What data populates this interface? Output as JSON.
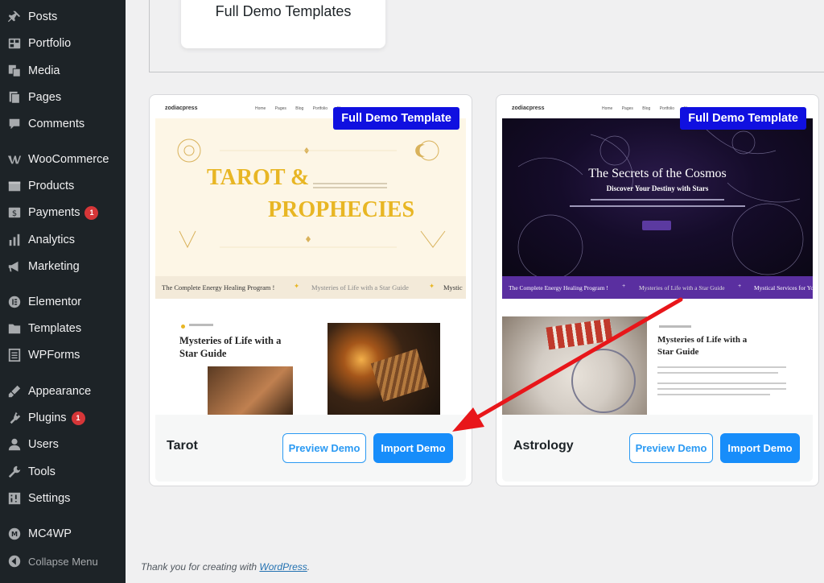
{
  "sidebar": {
    "items": [
      {
        "label": "Posts",
        "icon": "pin-icon"
      },
      {
        "label": "Portfolio",
        "icon": "portfolio-icon"
      },
      {
        "label": "Media",
        "icon": "media-icon"
      },
      {
        "label": "Pages",
        "icon": "pages-icon"
      },
      {
        "label": "Comments",
        "icon": "comments-icon"
      },
      {
        "label": "WooCommerce",
        "icon": "woocommerce-icon"
      },
      {
        "label": "Products",
        "icon": "products-icon"
      },
      {
        "label": "Payments",
        "icon": "payments-icon",
        "badge": "1"
      },
      {
        "label": "Analytics",
        "icon": "analytics-icon"
      },
      {
        "label": "Marketing",
        "icon": "marketing-icon"
      },
      {
        "label": "Elementor",
        "icon": "elementor-icon"
      },
      {
        "label": "Templates",
        "icon": "templates-icon"
      },
      {
        "label": "WPForms",
        "icon": "wpforms-icon"
      },
      {
        "label": "Appearance",
        "icon": "appearance-icon"
      },
      {
        "label": "Plugins",
        "icon": "plugins-icon",
        "badge": "1"
      },
      {
        "label": "Users",
        "icon": "users-icon"
      },
      {
        "label": "Tools",
        "icon": "tools-icon"
      },
      {
        "label": "Settings",
        "icon": "settings-icon"
      },
      {
        "label": "MC4WP",
        "icon": "mc4wp-icon"
      },
      {
        "label": "Collapse Menu",
        "icon": "collapse-icon"
      }
    ]
  },
  "top_card": {
    "title": "Full Demo Templates"
  },
  "cards": [
    {
      "name": "Tarot",
      "badge": "Full Demo Template",
      "preview_label": "Preview Demo",
      "import_label": "Import Demo",
      "thumb": {
        "logo": "zodiacpress",
        "nav": "Home Pages Blog Portfolio Shop",
        "headline_1": "TAROT &",
        "headline_2": "PROPHECIES",
        "ticker_1": "The Complete Energy Healing Program !",
        "ticker_2": "Mysteries of Life with a Star Guide",
        "ticker_3": "Mystic",
        "section_title": "Mysteries of Life with a Star Guide"
      }
    },
    {
      "name": "Astrology",
      "badge": "Full Demo Template",
      "preview_label": "Preview Demo",
      "import_label": "Import Demo",
      "thumb": {
        "logo": "zodiacpress",
        "nav": "Home Pages Blog Portfolio Shop",
        "headline_1": "The Secrets of the Cosmos",
        "headline_2": "Discover Your Destiny with Stars",
        "ticker_1": "The Complete Energy Healing Program !",
        "ticker_2": "Mysteries of Life with a Star Guide",
        "ticker_3": "Mystical Services for You",
        "section_title": "Mysteries of Life with a Star Guide"
      }
    }
  ],
  "footer": {
    "text": "Thank you for creating with ",
    "link": "WordPress",
    "period": "."
  },
  "colors": {
    "sidebar_bg": "#1d2327",
    "badge_bg": "#1010e0",
    "import_bg": "#178dfa",
    "arrow": "#e8161a"
  }
}
